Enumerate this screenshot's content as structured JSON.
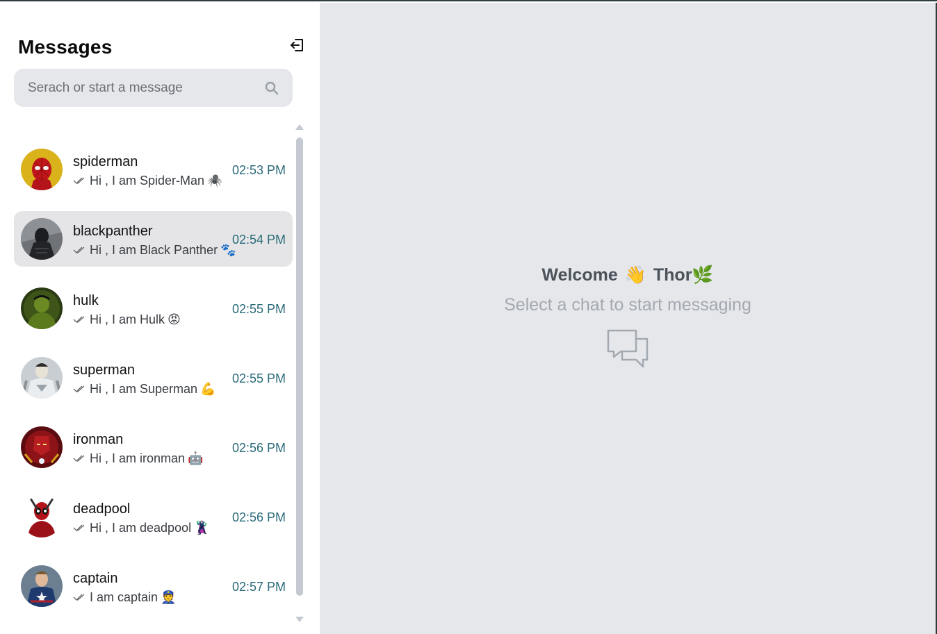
{
  "sidebar": {
    "title": "Messages",
    "logout_icon": "logout-icon",
    "search": {
      "placeholder": "Serach or start a message",
      "icon": "search-icon"
    }
  },
  "chats": [
    {
      "name": "spiderman",
      "preview": "Hi , I am Spider-Man",
      "emoji": "🕷️",
      "time": "02:53 PM",
      "active": false
    },
    {
      "name": "blackpanther",
      "preview": "Hi , I am Black Panther",
      "emoji": "🐾",
      "time": "02:54 PM",
      "active": true
    },
    {
      "name": "hulk",
      "preview": "Hi , I am Hulk",
      "emoji": "😡",
      "time": "02:55 PM",
      "active": false
    },
    {
      "name": "superman",
      "preview": "Hi , I am Superman",
      "emoji": "💪",
      "time": "02:55 PM",
      "active": false
    },
    {
      "name": "ironman",
      "preview": "Hi , I am ironman",
      "emoji": "🤖",
      "time": "02:56 PM",
      "active": false
    },
    {
      "name": "deadpool",
      "preview": "Hi , I am deadpool",
      "emoji": "🦹",
      "time": "02:56 PM",
      "active": false
    },
    {
      "name": "captain",
      "preview": "I am captain",
      "emoji": "👮",
      "time": "02:57 PM",
      "active": false
    }
  ],
  "main": {
    "welcome": "Welcome",
    "wave_emoji": "👋",
    "username": "Thor",
    "user_emoji": "🌿",
    "subtitle": "Select a chat to start messaging",
    "icon": "chat-bubbles-icon"
  },
  "colors": {
    "sidebar_bg": "#ffffff",
    "main_bg": "#e5e7eb",
    "search_bg": "#e5e7eb",
    "active_item_bg": "#e5e5e7",
    "time_color": "#2b6b7a",
    "subtitle_color": "#a4a9b1"
  }
}
